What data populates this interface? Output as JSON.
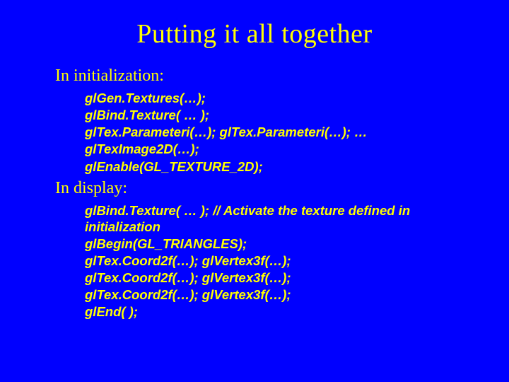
{
  "title": "Putting it all together",
  "section1": "In initialization:",
  "init": {
    "l0": "glGen.Textures(…);",
    "l1": "glBind.Texture( … );",
    "l2": "glTex.Parameteri(…); glTex.Parameteri(…); …",
    "l3": "glTexImage2D(…);",
    "l4": "glEnable(GL_TEXTURE_2D);"
  },
  "section2": "In display:",
  "disp": {
    "l0": "glBind.Texture( … );  // Activate the texture defined in initialization",
    "l1": "glBegin(GL_TRIANGLES);",
    "l2": " glTex.Coord2f(…); glVertex3f(…);",
    "l3": "glTex.Coord2f(…); glVertex3f(…);",
    "l4": "glTex.Coord2f(…); glVertex3f(…);",
    "l5": "glEnd( );"
  }
}
